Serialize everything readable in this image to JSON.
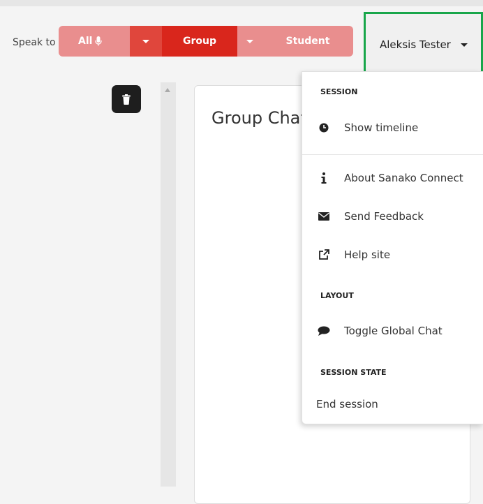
{
  "toolbar": {
    "speak_to_label": "Speak to",
    "all_label": "All",
    "group_label": "Group",
    "student_label": "Student"
  },
  "user_menu": {
    "name": "Aleksis Tester"
  },
  "chat": {
    "title": "Group Chat"
  },
  "menu": {
    "session_header": "SESSION",
    "show_timeline": "Show timeline",
    "about": "About Sanako Connect",
    "send_feedback": "Send Feedback",
    "help_site": "Help site",
    "layout_header": "LAYOUT",
    "toggle_global_chat": "Toggle Global Chat",
    "session_state_header": "SESSION STATE",
    "end_session": "End session"
  },
  "colors": {
    "accent_red": "#d9261c",
    "light_red": "#e98e8e",
    "highlight_green": "#18a64a"
  },
  "icons": {
    "mic": "microphone-icon",
    "trash": "trash-icon",
    "timeline": "clock-icon",
    "about": "info-icon",
    "feedback": "envelope-icon",
    "help": "external-link-icon",
    "chat": "speech-bubble-icon"
  }
}
